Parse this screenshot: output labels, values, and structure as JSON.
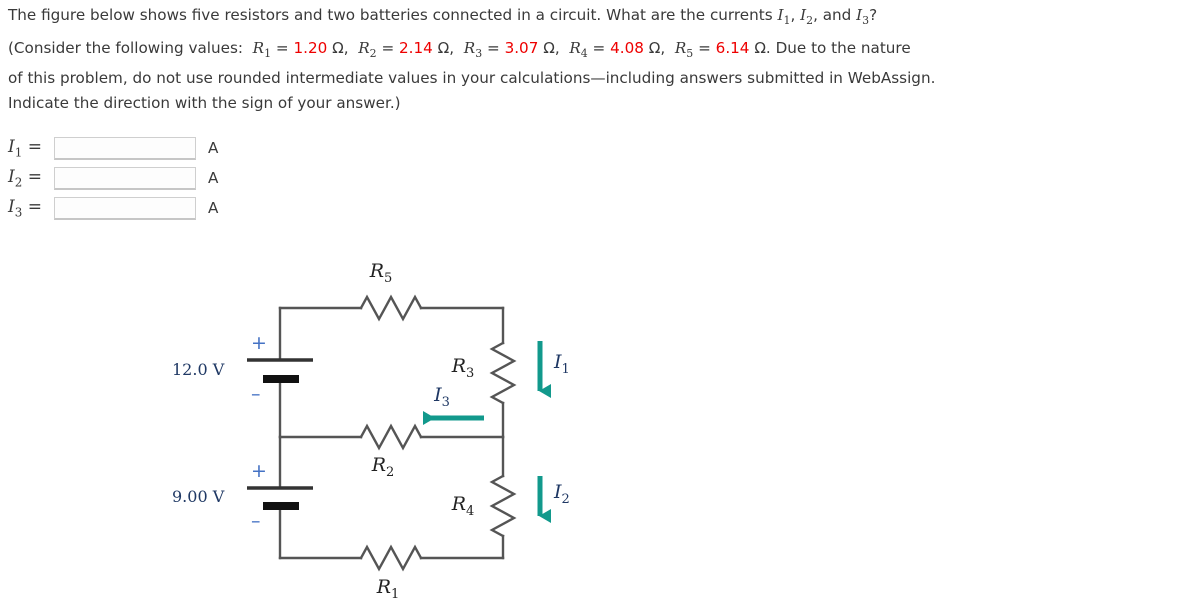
{
  "question": {
    "line1_a": "The figure below shows five resistors and two batteries connected in a circuit. What are the currents ",
    "line1_i1": "I",
    "line1_i1_sub": "1",
    "line1_sep1": ", ",
    "line1_i2": "I",
    "line1_i2_sub": "2",
    "line1_sep2": ", and ",
    "line1_i3": "I",
    "line1_i3_sub": "3",
    "line1_end": "?",
    "para_open": "(Consider the following values:",
    "resistors": [
      {
        "symbol": "R",
        "sub": "1",
        "eq": "=",
        "value": "1.20",
        "unit": "Ω,"
      },
      {
        "symbol": "R",
        "sub": "2",
        "eq": "=",
        "value": "2.14",
        "unit": "Ω,"
      },
      {
        "symbol": "R",
        "sub": "3",
        "eq": "=",
        "value": "3.07",
        "unit": "Ω,"
      },
      {
        "symbol": "R",
        "sub": "4",
        "eq": "=",
        "value": "4.08",
        "unit": "Ω,"
      },
      {
        "symbol": "R",
        "sub": "5",
        "eq": "=",
        "value": "6.14",
        "unit": "Ω."
      }
    ],
    "para_tail1": "Due to the nature",
    "para_line2": "of this problem, do not use rounded intermediate values in your calculations—including answers submitted in WebAssign.",
    "para_line3": "Indicate the direction with the sign of your answer.)"
  },
  "answers": [
    {
      "symbol": "I",
      "sub": "1",
      "eq": "=",
      "value": "",
      "placeholder": "",
      "unit": "A"
    },
    {
      "symbol": "I",
      "sub": "2",
      "eq": "=",
      "value": "",
      "placeholder": "",
      "unit": "A"
    },
    {
      "symbol": "I",
      "sub": "3",
      "eq": "=",
      "value": "",
      "placeholder": "",
      "unit": "A"
    }
  ],
  "figure": {
    "resistor_labels": {
      "r5": "R",
      "r5_sub": "5",
      "r3": "R",
      "r3_sub": "3",
      "r2": "R",
      "r2_sub": "2",
      "r4": "R",
      "r4_sub": "4",
      "r1": "R",
      "r1_sub": "1"
    },
    "current_labels": {
      "i1": "I",
      "i1_sub": "1",
      "i2": "I",
      "i2_sub": "2",
      "i3": "I",
      "i3_sub": "3"
    },
    "batteries": [
      {
        "name": "battery-12v",
        "label": "12.0 V",
        "plus": "+",
        "minus": "–"
      },
      {
        "name": "battery-9v",
        "label": "9.00 V",
        "plus": "+",
        "minus": "–"
      }
    ],
    "colors": {
      "wire": "#555555",
      "arrow_teal": "#12998c",
      "label_navy": "#1f3864",
      "sign_blue": "#4472c4",
      "resistor_value_red": "#ee0000"
    }
  }
}
